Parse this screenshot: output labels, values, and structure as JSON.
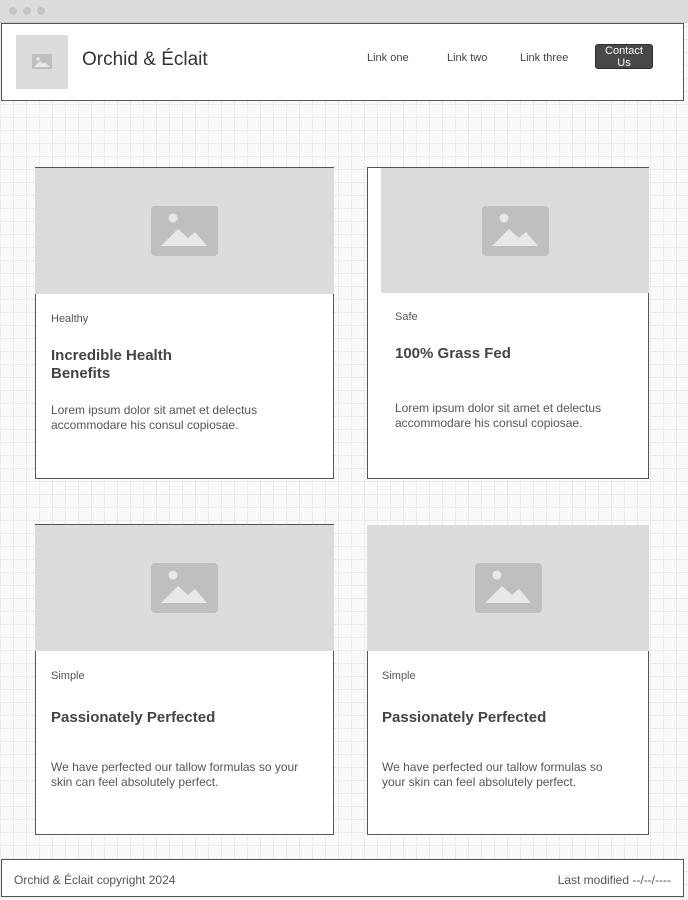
{
  "window": {
    "dots": 3
  },
  "header": {
    "brand": "Orchid & Éclait",
    "logo_icon": "image-icon",
    "nav": [
      {
        "label": "Link one"
      },
      {
        "label": "Link two"
      },
      {
        "label": "Link three"
      }
    ],
    "contact_label_line1": "Contact",
    "contact_label_line2": "Us"
  },
  "cards": [
    {
      "tag": "Healthy",
      "title_line1": "Incredible Health",
      "title_line2": "Benefits",
      "body_line1": "Lorem ipsum dolor sit amet et delectus",
      "body_line2": "accommodare his consul copiosae."
    },
    {
      "tag": "Safe",
      "title_line1": "100% Grass Fed",
      "title_line2": "",
      "body_line1": "Lorem ipsum dolor sit amet et delectus",
      "body_line2": "accommodare his consul copiosae."
    },
    {
      "tag": "Simple",
      "title_line1": "Passionately Perfected",
      "title_line2": "",
      "body_line1": "We have perfected our tallow formulas so your",
      "body_line2": "skin can feel absolutely perfect."
    },
    {
      "tag": "Simple",
      "title_line1": "Passionately Perfected",
      "title_line2": "",
      "body_line1": "We have perfected our tallow formulas so",
      "body_line2": "your skin can feel absolutely perfect."
    }
  ],
  "footer": {
    "copyright": "Orchid & Éclait copyright 2024",
    "last_modified": "Last modified --/--/----"
  },
  "colors": {
    "placeholder": "#dcdcdc",
    "placeholder_icon": "#bfbfbf",
    "button": "#484848",
    "border": "#555555"
  }
}
